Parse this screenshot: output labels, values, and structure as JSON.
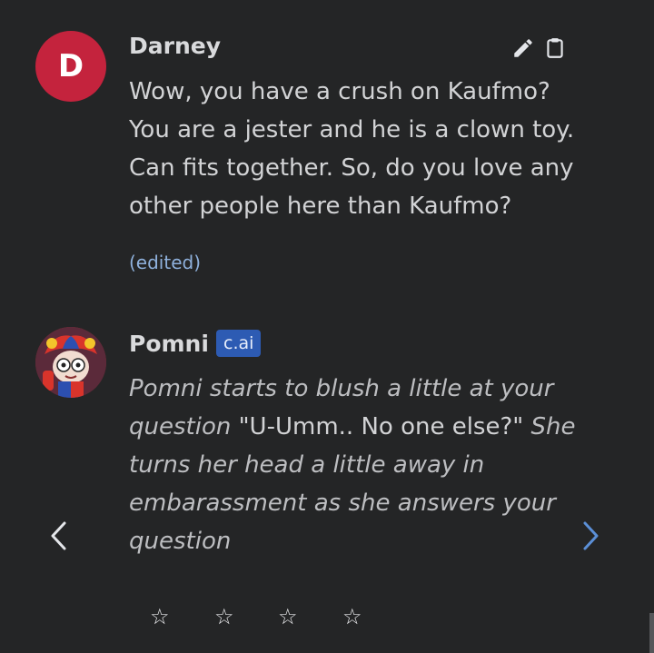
{
  "messages": [
    {
      "author": "Darney",
      "avatar_letter": "D",
      "text": "Wow, you have a crush on Kaufmo? You are a jester and he is a clown toy. Can fits together. So, do you love any other people here than Kaufmo?",
      "edited_label": "(edited)",
      "actions": [
        "pencil-icon",
        "clipboard-icon"
      ]
    },
    {
      "author": "Pomni",
      "badge": "c.ai",
      "segments": [
        {
          "style": "italic",
          "text": "Pomni starts to blush a little at your question "
        },
        {
          "style": "normal",
          "text": "\"U-Umm.. No one else?\" "
        },
        {
          "style": "italic",
          "text": "She turns her head a little away in embarassment as she answers your question"
        }
      ]
    }
  ],
  "rating": {
    "stars": [
      "☆",
      "☆",
      "☆",
      "☆"
    ],
    "selected": 0
  },
  "colors": {
    "background": "#242526",
    "avatar_d": "#c4233d",
    "badge": "#2d5bb3",
    "edited": "#8fb1dc",
    "next_arrow": "#5b8fd6"
  },
  "icons": {
    "edit": "pencil-icon",
    "copy": "clipboard-icon",
    "prev": "chevron-left-icon",
    "next": "chevron-right-icon",
    "star": "star-outline-icon"
  }
}
